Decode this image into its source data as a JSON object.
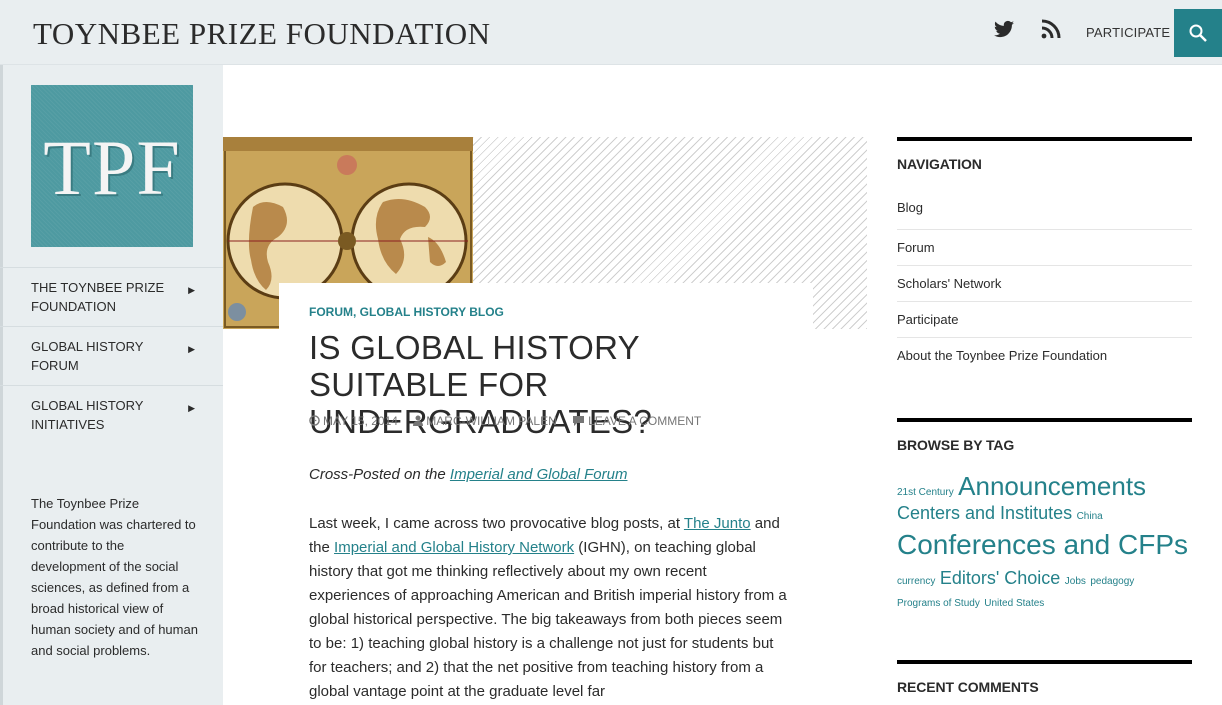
{
  "header": {
    "site_title": "TOYNBEE PRIZE FOUNDATION",
    "participate": "PARTICIPATE",
    "accent_color": "#24818a"
  },
  "sidebar": {
    "logo_text": "TPF",
    "nav_items": [
      {
        "label": "THE TOYNBEE PRIZE FOUNDATION"
      },
      {
        "label": "GLOBAL HISTORY FORUM"
      },
      {
        "label": "GLOBAL HISTORY INITIATIVES"
      }
    ],
    "description": "The Toynbee Prize Foundation was chartered to contribute to the development of the social sciences, as defined from a broad historical view of human society and of human and social problems."
  },
  "post": {
    "categories": "FORUM, GLOBAL HISTORY BLOG",
    "title": "IS GLOBAL HISTORY SUITABLE FOR UNDERGRADUATES?",
    "date": "MAY 15, 2014",
    "author": "MARC-WILLIAM PALEN",
    "comment_link": "LEAVE A COMMENT",
    "crosspost_prefix": "Cross-Posted on the ",
    "crosspost_link": "Imperial and Global Forum ",
    "body": {
      "p1_a": "Last week, I came across two provocative blog posts, at ",
      "link_junto": "The Junto",
      "p1_b": " and the ",
      "link_ighn": "Imperial and Global History Network",
      "p1_c": " (IGHN), on teaching global history that got me thinking reflectively about my own recent experiences of approaching American and British imperial history from a global historical perspective. The big takeaways from both pieces seem to be: 1) teaching global history is a challenge not just for students but for teachers; and 2) that the net positive from teaching history from a global vantage point at the graduate level far"
    }
  },
  "widgets": {
    "navigation": {
      "title": "NAVIGATION",
      "items": [
        "Blog",
        "Forum",
        "Scholars' Network",
        "Participate",
        "About the Toynbee Prize Foundation"
      ]
    },
    "tags": {
      "title": "BROWSE BY TAG",
      "items": [
        "21st Century",
        "Announcements",
        "Centers and Institutes",
        "China",
        "Conferences and CFPs",
        "currency",
        "Editors' Choice",
        "Jobs",
        "pedagogy",
        "Programs of Study",
        "United States"
      ]
    },
    "recent_comments": {
      "title": "RECENT COMMENTS"
    }
  }
}
